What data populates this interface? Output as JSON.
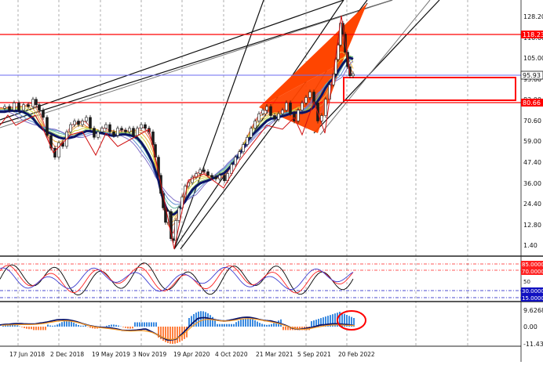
{
  "colors": {
    "background": "#ffffff",
    "grid": "#8a8a8a",
    "price_line": "#1a1a1a",
    "support_resistance": "#ff0000",
    "current_price_line": "#6a6af0",
    "ema_main": "#0b1468",
    "harmonic_fill": "#ff4500",
    "osc_k": "#000000",
    "osc_d": "#ff2020",
    "osc_signal": "#3a3ad0",
    "level_85": "#ff2020",
    "level_30": "#1010c0",
    "macd_positive": "#3a8ae0",
    "macd_negative": "#ff8040",
    "macd_line": "#0b1468",
    "macd_signal": "#ff9a20",
    "highlight_circle": "#ff0000"
  },
  "price_axis": {
    "ticks": [
      "128.20",
      "116.60",
      "105.00",
      "93.60",
      "82.00",
      "70.60",
      "59.00",
      "47.40",
      "36.00",
      "24.40",
      "12.80",
      "1.40"
    ],
    "current_price_label": "95.93",
    "resistance_label": "118.23",
    "support_label": "80.66"
  },
  "oscillator": {
    "levels": [
      {
        "label": "85.0000",
        "style": "red"
      },
      {
        "label": "70.0000",
        "style": "red"
      },
      {
        "label": "50",
        "style": "plain"
      },
      {
        "label": "30.0000",
        "style": "blue"
      },
      {
        "label": "15.0000",
        "style": "blue"
      }
    ]
  },
  "macd": {
    "ticks": [
      "9.6268",
      "0.00",
      "-11.4334"
    ]
  },
  "time_axis": {
    "labels": [
      "17 Jun 2018",
      "2 Dec 2018",
      "19 May 2019",
      "3 Nov 2019",
      "19 Apr 2020",
      "4 Oct 2020",
      "21 Mar 2021",
      "5 Sep 2021",
      "20 Feb 2022"
    ]
  },
  "chart_data": {
    "type": "candlestick",
    "price_series": [
      [
        0,
        77
      ],
      [
        6,
        78
      ],
      [
        12,
        76
      ],
      [
        18,
        80
      ],
      [
        24,
        76
      ],
      [
        30,
        79
      ],
      [
        36,
        78
      ],
      [
        42,
        82
      ],
      [
        46,
        79
      ],
      [
        50,
        76
      ],
      [
        55,
        72
      ],
      [
        60,
        62
      ],
      [
        65,
        55
      ],
      [
        70,
        50
      ],
      [
        75,
        58
      ],
      [
        80,
        56
      ],
      [
        85,
        64
      ],
      [
        90,
        68
      ],
      [
        95,
        70
      ],
      [
        100,
        68
      ],
      [
        105,
        70
      ],
      [
        110,
        72
      ],
      [
        115,
        66
      ],
      [
        120,
        61
      ],
      [
        125,
        64
      ],
      [
        130,
        66
      ],
      [
        135,
        68
      ],
      [
        140,
        64
      ],
      [
        145,
        62
      ],
      [
        150,
        66
      ],
      [
        155,
        65
      ],
      [
        160,
        64
      ],
      [
        165,
        66
      ],
      [
        170,
        62
      ],
      [
        175,
        66
      ],
      [
        180,
        68
      ],
      [
        185,
        66
      ],
      [
        190,
        64
      ],
      [
        195,
        57
      ],
      [
        198,
        50
      ],
      [
        202,
        40
      ],
      [
        205,
        30
      ],
      [
        208,
        22
      ],
      [
        211,
        14
      ],
      [
        214,
        20
      ],
      [
        218,
        5
      ],
      [
        221,
        4
      ],
      [
        224,
        15
      ],
      [
        228,
        22
      ],
      [
        232,
        28
      ],
      [
        236,
        34
      ],
      [
        240,
        36
      ],
      [
        245,
        39
      ],
      [
        250,
        41
      ],
      [
        255,
        43
      ],
      [
        260,
        42
      ],
      [
        265,
        40
      ],
      [
        270,
        39
      ],
      [
        275,
        38
      ],
      [
        280,
        40
      ],
      [
        286,
        37
      ],
      [
        290,
        41
      ],
      [
        295,
        46
      ],
      [
        300,
        50
      ],
      [
        305,
        53
      ],
      [
        310,
        57
      ],
      [
        315,
        61
      ],
      [
        320,
        66
      ],
      [
        325,
        70
      ],
      [
        330,
        74
      ],
      [
        335,
        76
      ],
      [
        340,
        78
      ],
      [
        345,
        73
      ],
      [
        350,
        71
      ],
      [
        355,
        74
      ],
      [
        360,
        76
      ],
      [
        365,
        80
      ],
      [
        370,
        74
      ],
      [
        375,
        70
      ],
      [
        380,
        76
      ],
      [
        385,
        80
      ],
      [
        390,
        83
      ],
      [
        395,
        86
      ],
      [
        400,
        80
      ],
      [
        405,
        70
      ],
      [
        410,
        73
      ],
      [
        415,
        82
      ],
      [
        420,
        90
      ],
      [
        425,
        96
      ],
      [
        428,
        104
      ],
      [
        431,
        112
      ],
      [
        434,
        124
      ],
      [
        437,
        118
      ],
      [
        440,
        108
      ],
      [
        443,
        100
      ],
      [
        446,
        95
      ],
      [
        450,
        96
      ]
    ],
    "resistance": 118.23,
    "support": 80.66,
    "current": 95.93,
    "x_labels": [
      "17 Jun 2018",
      "2 Dec 2018",
      "19 May 2019",
      "3 Nov 2019",
      "19 Apr 2020",
      "4 Oct 2020",
      "21 Mar 2021",
      "5 Sep 2021",
      "20 Feb 2022"
    ],
    "y_ticks": [
      128.2,
      116.6,
      105.0,
      93.6,
      82.0,
      70.6,
      59.0,
      47.4,
      36.0,
      24.4,
      12.8,
      1.4
    ],
    "osc_levels": [
      85,
      70,
      50,
      30,
      15
    ],
    "macd_ticks": [
      9.6268,
      0.0,
      -11.4334
    ]
  }
}
